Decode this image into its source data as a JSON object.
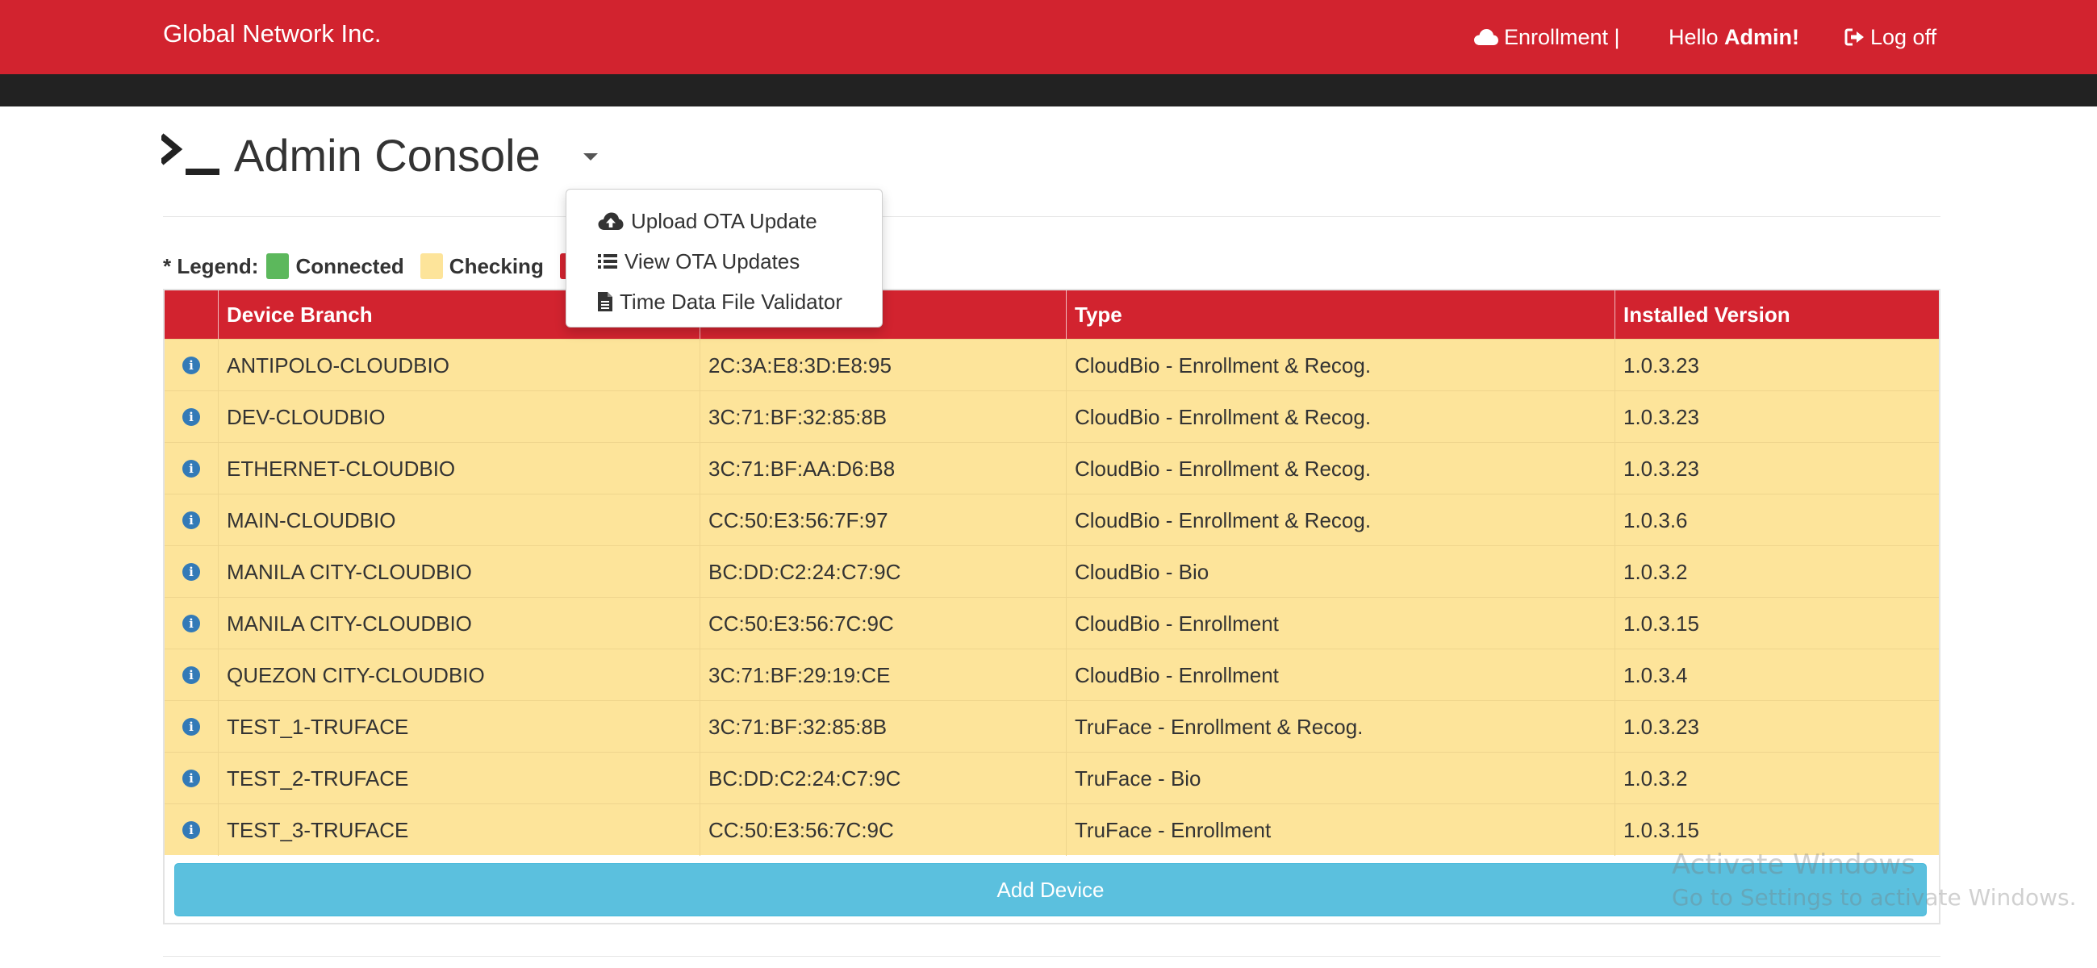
{
  "app": {
    "brand": "Global Network Inc."
  },
  "nav": {
    "enrollment_label": "Enrollment |",
    "hello_prefix": "Hello ",
    "hello_user": "Admin!",
    "logoff_label": "Log off"
  },
  "page": {
    "title": "Admin Console"
  },
  "legend": {
    "prefix": "* Legend:",
    "items": [
      {
        "label": "Connected",
        "color": "#5cb85c"
      },
      {
        "label": "Checking",
        "color": "#fde49a"
      }
    ]
  },
  "dropdown": {
    "items": [
      {
        "label": "Upload OTA Update",
        "icon": "cloud-upload-icon"
      },
      {
        "label": "View OTA Updates",
        "icon": "list-icon"
      },
      {
        "label": "Time Data File Validator",
        "icon": "file-icon"
      }
    ]
  },
  "table": {
    "headers": [
      "Device Branch",
      "",
      "Type",
      "Installed Version"
    ],
    "rows": [
      {
        "branch": "ANTIPOLO-CLOUDBIO",
        "mac": "2C:3A:E8:3D:E8:95",
        "type": "CloudBio - Enrollment & Recog.",
        "version": "1.0.3.23"
      },
      {
        "branch": "DEV-CLOUDBIO",
        "mac": "3C:71:BF:32:85:8B",
        "type": "CloudBio - Enrollment & Recog.",
        "version": "1.0.3.23"
      },
      {
        "branch": "ETHERNET-CLOUDBIO",
        "mac": "3C:71:BF:AA:D6:B8",
        "type": "CloudBio - Enrollment & Recog.",
        "version": "1.0.3.23"
      },
      {
        "branch": "MAIN-CLOUDBIO",
        "mac": "CC:50:E3:56:7F:97",
        "type": "CloudBio - Enrollment & Recog.",
        "version": "1.0.3.6"
      },
      {
        "branch": "MANILA CITY-CLOUDBIO",
        "mac": "BC:DD:C2:24:C7:9C",
        "type": "CloudBio - Bio",
        "version": "1.0.3.2"
      },
      {
        "branch": "MANILA CITY-CLOUDBIO",
        "mac": "CC:50:E3:56:7C:9C",
        "type": "CloudBio - Enrollment",
        "version": "1.0.3.15"
      },
      {
        "branch": "QUEZON CITY-CLOUDBIO",
        "mac": "3C:71:BF:29:19:CE",
        "type": "CloudBio - Enrollment",
        "version": "1.0.3.4"
      },
      {
        "branch": "TEST_1-TRUFACE",
        "mac": "3C:71:BF:32:85:8B",
        "type": "TruFace - Enrollment & Recog.",
        "version": "1.0.3.23"
      },
      {
        "branch": "TEST_2-TRUFACE",
        "mac": "BC:DD:C2:24:C7:9C",
        "type": "TruFace - Bio",
        "version": "1.0.3.2"
      },
      {
        "branch": "TEST_3-TRUFACE",
        "mac": "CC:50:E3:56:7C:9C",
        "type": "TruFace - Enrollment",
        "version": "1.0.3.15"
      }
    ],
    "add_button": "Add Device"
  },
  "watermark": {
    "line1": "Activate Windows",
    "line2": "Go to Settings to activate Windows."
  },
  "colors": {
    "brand_red": "#d2232f",
    "row_checking": "#fde49a",
    "add_button": "#5bc0de",
    "info_icon": "#337ab7"
  }
}
